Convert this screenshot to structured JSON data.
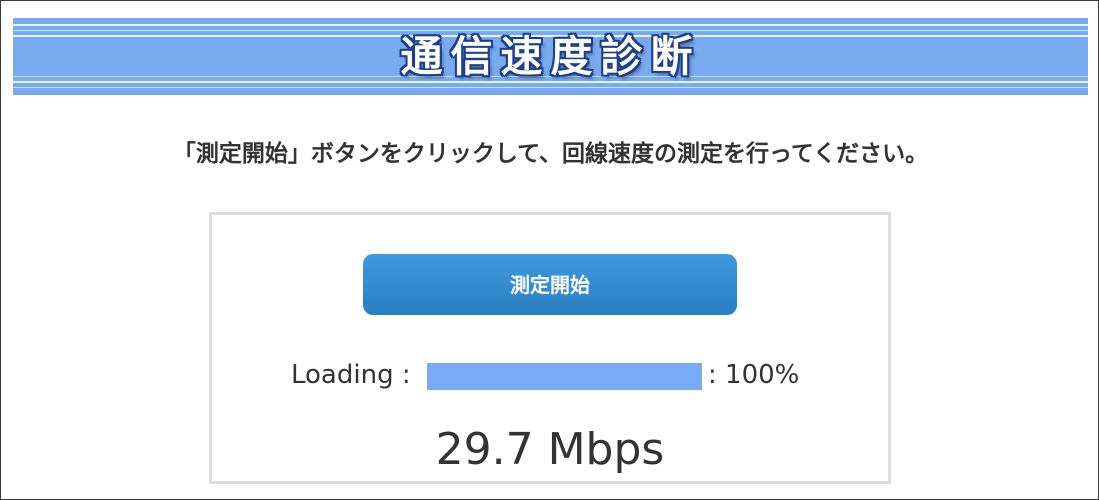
{
  "header": {
    "title": "通信速度診断"
  },
  "instruction": {
    "text": "「測定開始」ボタンをクリックして、回線速度の測定を行ってください。"
  },
  "panel": {
    "start_button_label": "測定開始",
    "loading_label": "Loading :",
    "loading_percent_label": ": 100%",
    "loading_progress": 1.0,
    "speed_result": "29.7 Mbps"
  },
  "colors": {
    "banner": "#78aaf0",
    "banner_title_outline": "#1e3f8a",
    "button_top": "#3d9ade",
    "button_bottom": "#2a7fc0",
    "progress_fill": "#78aaf5",
    "panel_border": "#dcdcdc",
    "text": "#333333"
  }
}
